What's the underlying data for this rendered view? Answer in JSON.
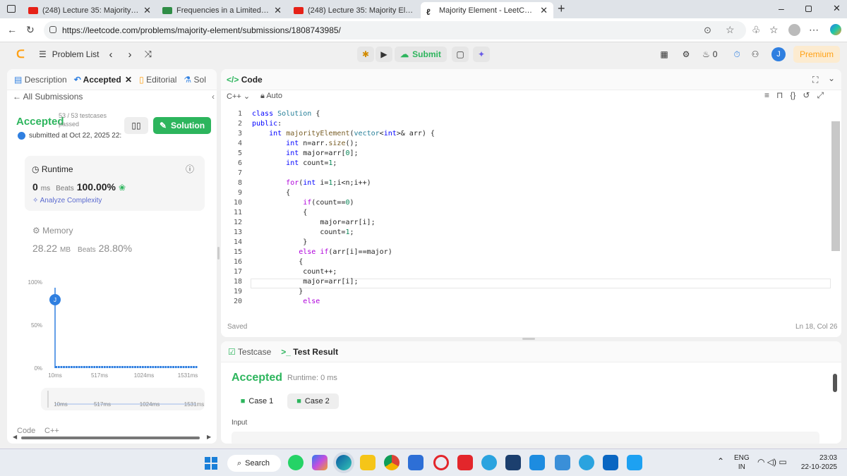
{
  "browser": {
    "tabs": [
      {
        "title": "(248) Lecture 35: Majority Elemen",
        "color": "#e62117"
      },
      {
        "title": "Frequencies in a Limited Array | P",
        "color": "#2f8d46"
      },
      {
        "title": "(248) Lecture 35: Majority Elemen",
        "color": "#e62117"
      },
      {
        "title": "Majority Element - LeetCode",
        "color": "#ffa116"
      }
    ],
    "url": "https://leetcode.com/problems/majority-element/submissions/1808743985/"
  },
  "nav": {
    "problem_list": "Problem List",
    "submit": "Submit",
    "streak": "0",
    "avatar": "J",
    "premium": "Premium"
  },
  "left": {
    "tabs": {
      "description": "Description",
      "accepted": "Accepted",
      "editorial": "Editorial",
      "solutions": "Sol"
    },
    "all_submissions": "All Submissions",
    "status": "Accepted",
    "testcases": "53 / 53 testcases",
    "passed": "passed",
    "submitted": "submitted at Oct 22, 2025 22:",
    "solution_btn": "Solution",
    "runtime": {
      "label": "Runtime",
      "value": "0",
      "unit": "ms",
      "beats_label": "Beats",
      "beats": "100.00%",
      "analyze": "Analyze Complexity"
    },
    "memory": {
      "label": "Memory",
      "value": "28.22",
      "unit": "MB",
      "beats_label": "Beats",
      "beats": "28.80%"
    },
    "footer_code": "Code",
    "footer_lang": "C++"
  },
  "chart_data": {
    "type": "bar",
    "yticks": [
      "100%",
      "50%",
      "0%"
    ],
    "xticks": [
      "10ms",
      "517ms",
      "1024ms",
      "1531ms"
    ],
    "marker": "J",
    "marker_value": 1.0,
    "bar_count": 56,
    "range_ticks": [
      "10ms",
      "517ms",
      "1024ms",
      "1531ms"
    ]
  },
  "code": {
    "title": "Code",
    "lang": "C++",
    "auto": "Auto",
    "lines": [
      "class Solution {",
      "public:",
      "    int majorityElement(vector<int>& arr) {",
      "        int n=arr.size();",
      "        int major=arr[0];",
      "        int count=1;",
      "",
      "        for(int i=1;i<n;i++)",
      "        {",
      "            if(count==0)",
      "            {",
      "                major=arr[i];",
      "                count=1;",
      "            }",
      "           else if(arr[i]==major)",
      "           {",
      "            count++;",
      "            major=arr[i];",
      "           }",
      "            else"
    ],
    "saved": "Saved",
    "cursor": "Ln 18, Col 26"
  },
  "result": {
    "tab_testcase": "Testcase",
    "tab_result": "Test Result",
    "status": "Accepted",
    "runtime": "Runtime: 0 ms",
    "case1": "Case 1",
    "case2": "Case 2",
    "input_label": "Input"
  },
  "taskbar": {
    "search": "Search",
    "lang1": "ENG",
    "lang2": "IN",
    "time": "23:03",
    "date": "22-10-2025"
  }
}
